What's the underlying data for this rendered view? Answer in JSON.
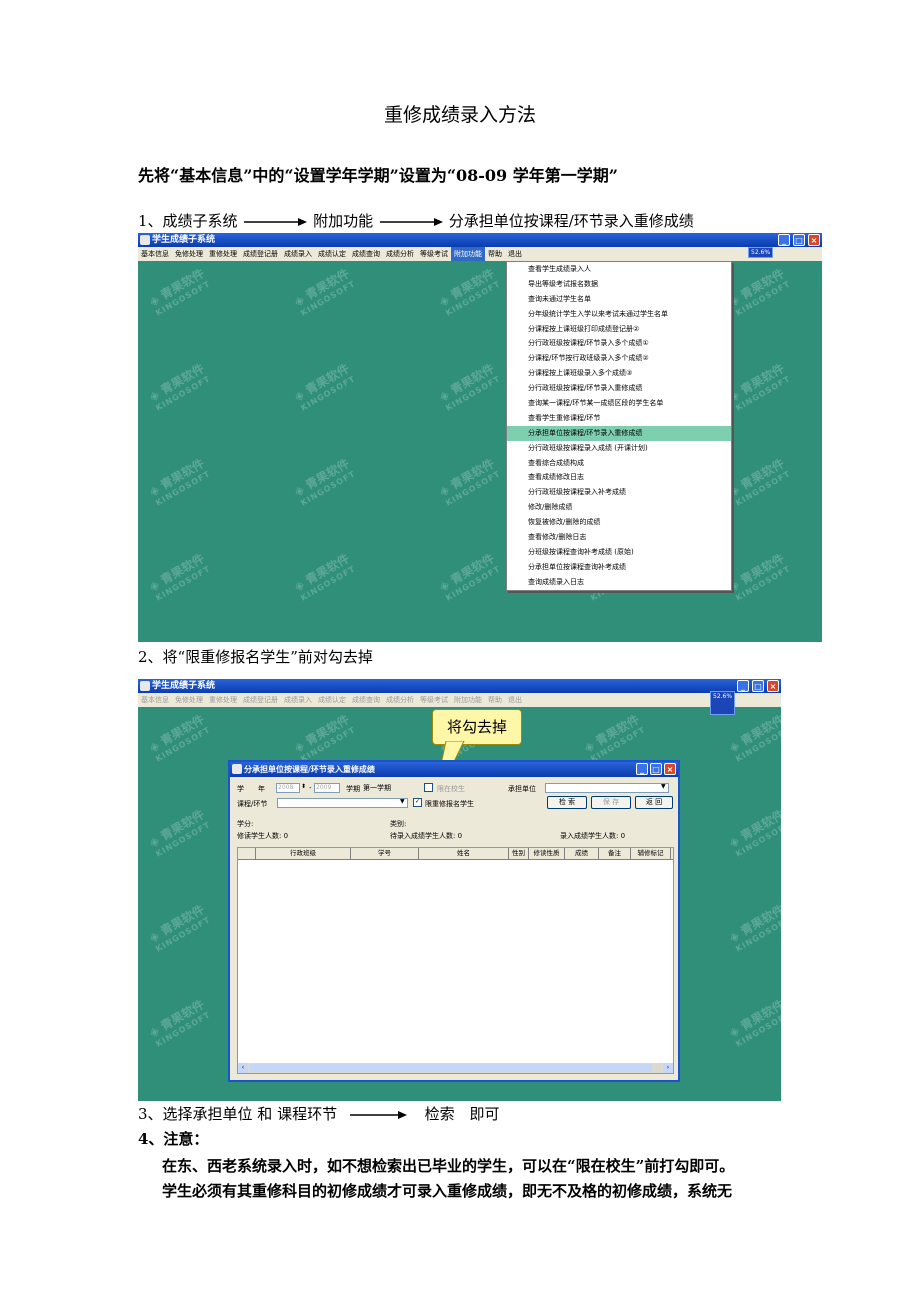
{
  "doc": {
    "title": "重修成绩录入方法",
    "heading": "先将“基本信息”中的“设置学年学期”设置为“08-09 学年第一学期”",
    "step1": {
      "prefix": "1、成绩子系统",
      "part2": "附加功能",
      "part3": "分承担单位按课程/环节录入重修成绩"
    },
    "step2": "2、将“限重修报名学生”前对勾去掉",
    "step3": {
      "prefix": "3、选择承担单位  和  课程环节",
      "part2": "检索",
      "part3": "即可"
    },
    "step4_label": "4、注意：",
    "note1": "在东、西老系统录入时，如不想检索出已毕业的学生，可以在“限在校生”前打勾即可。",
    "note2": "学生必须有其重修科目的初修成绩才可录入重修成绩，即无不及格的初修成绩，系统无"
  },
  "app": {
    "window_title": "学生成绩子系统",
    "percent_badge": "52.6%",
    "menu": [
      "基本信息",
      "免修处理",
      "重修处理",
      "成绩登记册",
      "成绩录入",
      "成绩认定",
      "成绩查询",
      "成绩分析",
      "等级考试",
      "附加功能",
      "帮助",
      "退出"
    ],
    "selected_menu": "附加功能",
    "watermark_cn": "青果软件",
    "watermark_en": "KINGOSOFT",
    "dropdown_items": [
      "查看学生成绩录入人",
      "导出等级考试报名数据",
      "查询未通过学生名单",
      "分年级统计学生入学以来考试未通过学生名单",
      "分课程按上课班级打印成绩登记册②",
      "分行政班级按课程/环节录入多个成绩①",
      "分课程/环节按行政班级录入多个成绩②",
      "分课程按上课班级录入多个成绩③",
      "分行政班级按课程/环节录入重修成绩",
      "查询某一课程/环节某一成绩区段的学生名单",
      "查看学生重修课程/环节",
      "分承担单位按课程/环节录入重修成绩",
      "分行政班级按课程录入成绩 (开课计划)",
      "查看综合成绩构成",
      "查看成绩修改日志",
      "分行政班级按课程录入补考成绩",
      "修改/删除成绩",
      "恢复被修改/删除的成绩",
      "查看修改/删除日志",
      "分班级按课程查询补考成绩 (原始)",
      "分承担单位按课程查询补考成绩",
      "查询成绩录入日志"
    ],
    "highlight_index": 11
  },
  "dialog": {
    "title": "分承担单位按课程/环节录入重修成绩",
    "xue": "学",
    "nian": "年",
    "year_from": "2008",
    "year_to": "2009",
    "term_label": "学期",
    "term_value": "第一学期",
    "limit_current_label": "限在校生",
    "limit_current_checked": false,
    "dept_label": "承担单位",
    "course_label": "课程/环节",
    "limit_retake_label": "限重修报名学生",
    "limit_retake_checked": true,
    "btn_search": "检 索",
    "btn_save": "保 存",
    "btn_back": "返 回",
    "credit_label": "学分:",
    "category_label": "类别:",
    "retake_count_label": "修读学生人数: 0",
    "pending_count_label": "待录入成绩学生人数: 0",
    "entered_count_label": "录入成绩学生人数: 0",
    "columns": [
      "行政班级",
      "学号",
      "姓名",
      "性别",
      "修读性质",
      "成绩",
      "备注",
      "辅修标记"
    ]
  },
  "callout": "将勾去掉"
}
